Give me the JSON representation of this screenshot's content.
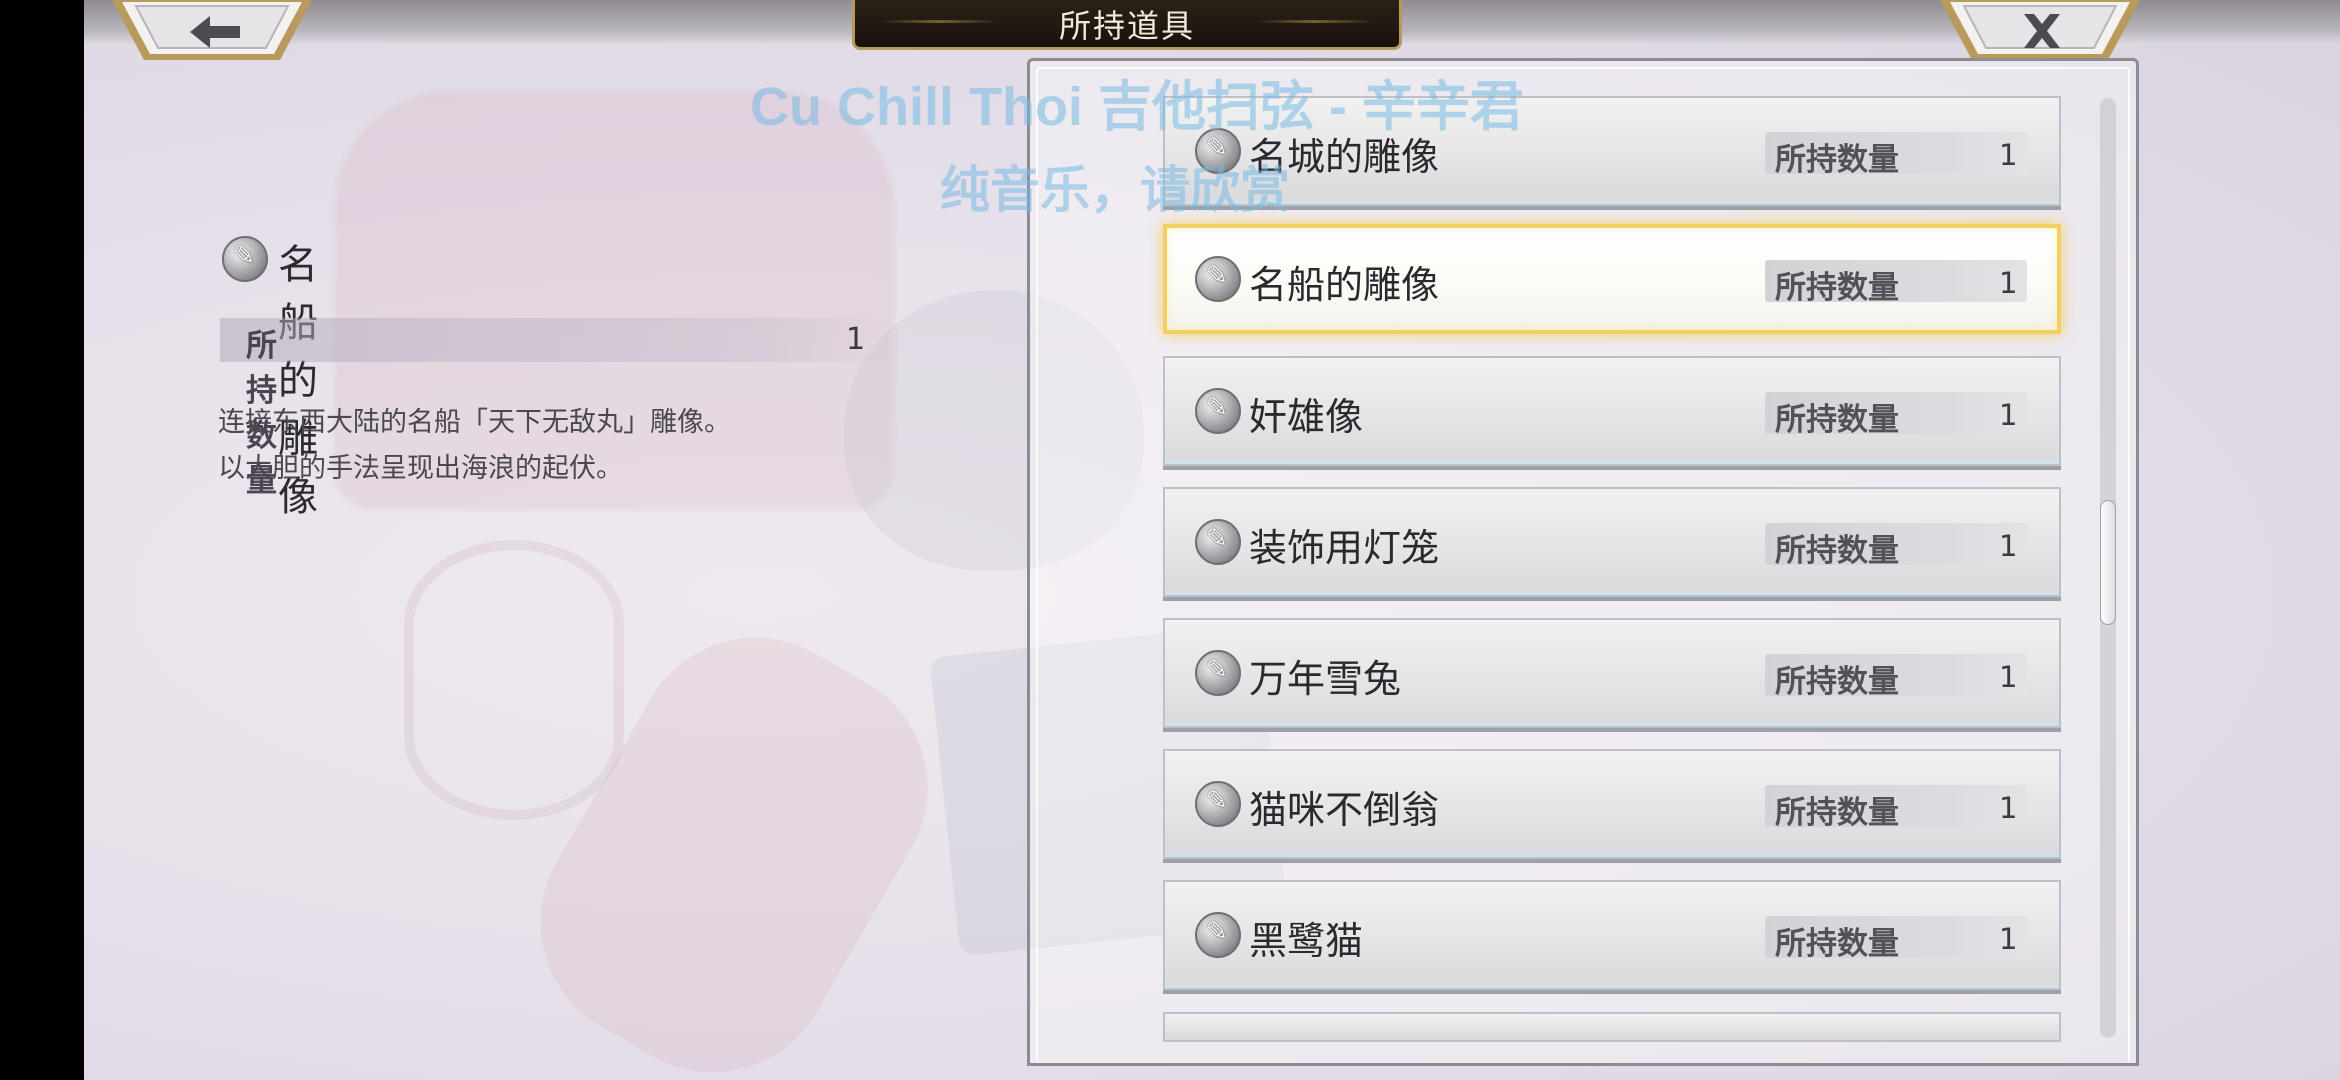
{
  "header": {
    "title": "所持道具",
    "back_icon": "arrow-left-icon",
    "close_icon": "close-x-icon"
  },
  "watermark": {
    "line1": "Cu Chill Thoi 吉他扫弦 - 辛辛君",
    "line2": "纯音乐，请欣赏"
  },
  "detail": {
    "icon": "statue-item-icon",
    "name": "名船的雕像",
    "qty_label": "所持数量",
    "qty_value": "1",
    "description": [
      "连接东西大陆的名船「天下无敌丸」雕像。",
      "以大胆的手法呈现出海浪的起伏。"
    ]
  },
  "items": [
    {
      "name": "名城的雕像",
      "qty_label": "所持数量",
      "qty": "1",
      "selected": false
    },
    {
      "name": "名船的雕像",
      "qty_label": "所持数量",
      "qty": "1",
      "selected": true
    },
    {
      "name": "奸雄像",
      "qty_label": "所持数量",
      "qty": "1",
      "selected": false
    },
    {
      "name": "装饰用灯笼",
      "qty_label": "所持数量",
      "qty": "1",
      "selected": false
    },
    {
      "name": "万年雪兔",
      "qty_label": "所持数量",
      "qty": "1",
      "selected": false
    },
    {
      "name": "猫咪不倒翁",
      "qty_label": "所持数量",
      "qty": "1",
      "selected": false
    },
    {
      "name": "黑鹭猫",
      "qty_label": "所持数量",
      "qty": "1",
      "selected": false
    }
  ],
  "scroll": {
    "position_fraction": 0.45
  },
  "colors": {
    "selected_border": "#f2cf63",
    "frame_gold": "#b99a5d",
    "watermark": "#78b9e1"
  }
}
